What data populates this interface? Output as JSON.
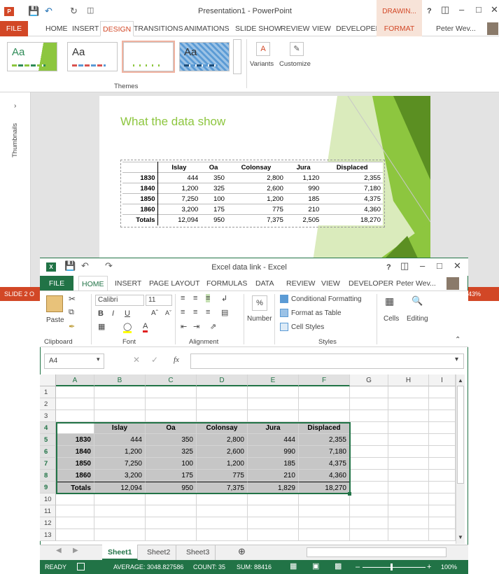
{
  "ppt": {
    "title": "Presentation1 - PowerPoint",
    "drawing_tab": "DRAWIN...",
    "help": "?",
    "user": "Peter Wev...",
    "tabs": [
      "FILE",
      "HOME",
      "INSERT",
      "DESIGN",
      "TRANSITIONS",
      "ANIMATIONS",
      "SLIDE SHOW",
      "REVIEW",
      "VIEW",
      "DEVELOPER"
    ],
    "format_tab": "FORMAT",
    "themes_label": "Themes",
    "variants_label": "Variants",
    "customize_label": "Customize",
    "theme_aa": "Aa",
    "thumbnails_label": "Thumbnails",
    "status_left": "SLIDE 2 O",
    "status_zoom": "43%",
    "slide": {
      "title": "What the data show",
      "table": {
        "headers": [
          "",
          "Islay",
          "Oa",
          "Colonsay",
          "Jura",
          "Displaced"
        ],
        "rows": [
          [
            "1830",
            "444",
            "350",
            "2,800",
            "1,120",
            "2,355"
          ],
          [
            "1840",
            "1,200",
            "325",
            "2,600",
            "990",
            "7,180"
          ],
          [
            "1850",
            "7,250",
            "100",
            "1,200",
            "185",
            "4,375"
          ],
          [
            "1860",
            "3,200",
            "175",
            "775",
            "210",
            "4,360"
          ],
          [
            "Totals",
            "12,094",
            "950",
            "7,375",
            "2,505",
            "18,270"
          ]
        ]
      }
    },
    "colors": {
      "accent": "#d24726",
      "slide_green": "#8dc63f"
    }
  },
  "excel": {
    "title": "Excel data link - Excel",
    "help": "?",
    "user": "Peter Wev...",
    "tabs": [
      "FILE",
      "HOME",
      "INSERT",
      "PAGE LAYOUT",
      "FORMULAS",
      "DATA",
      "REVIEW",
      "VIEW",
      "DEVELOPER"
    ],
    "ribbon": {
      "paste": "Paste",
      "clipboard": "Clipboard",
      "font_name": "Calibri",
      "font_size": "11",
      "font": "Font",
      "alignment": "Alignment",
      "number": "Number",
      "percent": "%",
      "conditional": "Conditional Formatting",
      "format_table": "Format as Table",
      "cell_styles": "Cell Styles",
      "styles": "Styles",
      "cells": "Cells",
      "editing": "Editing",
      "bold": "B",
      "italic": "I",
      "underline": "U"
    },
    "name_box": "A4",
    "fx": "fx",
    "columns": [
      "A",
      "B",
      "C",
      "D",
      "E",
      "F",
      "G",
      "H",
      "I"
    ],
    "row_numbers": [
      "1",
      "2",
      "3",
      "4",
      "5",
      "6",
      "7",
      "8",
      "9",
      "10",
      "11",
      "12",
      "13"
    ],
    "table": {
      "headers": [
        "",
        "Islay",
        "Oa",
        "Colonsay",
        "Jura",
        "Displaced"
      ],
      "rows": [
        [
          "1830",
          "444",
          "350",
          "2,800",
          "444",
          "2,355"
        ],
        [
          "1840",
          "1,200",
          "325",
          "2,600",
          "990",
          "7,180"
        ],
        [
          "1850",
          "7,250",
          "100",
          "1,200",
          "185",
          "4,375"
        ],
        [
          "1860",
          "3,200",
          "175",
          "775",
          "210",
          "4,360"
        ],
        [
          "Totals",
          "12,094",
          "950",
          "7,375",
          "1,829",
          "18,270"
        ]
      ]
    },
    "sheets": [
      "Sheet1",
      "Sheet2",
      "Sheet3"
    ],
    "add_sheet": "⊕",
    "status": {
      "ready": "READY",
      "average": "AVERAGE: 3048.827586",
      "count": "COUNT: 35",
      "sum": "SUM: 88416",
      "zoom": "100%"
    },
    "colors": {
      "accent": "#217346",
      "selection": "#c6c6c6"
    }
  }
}
